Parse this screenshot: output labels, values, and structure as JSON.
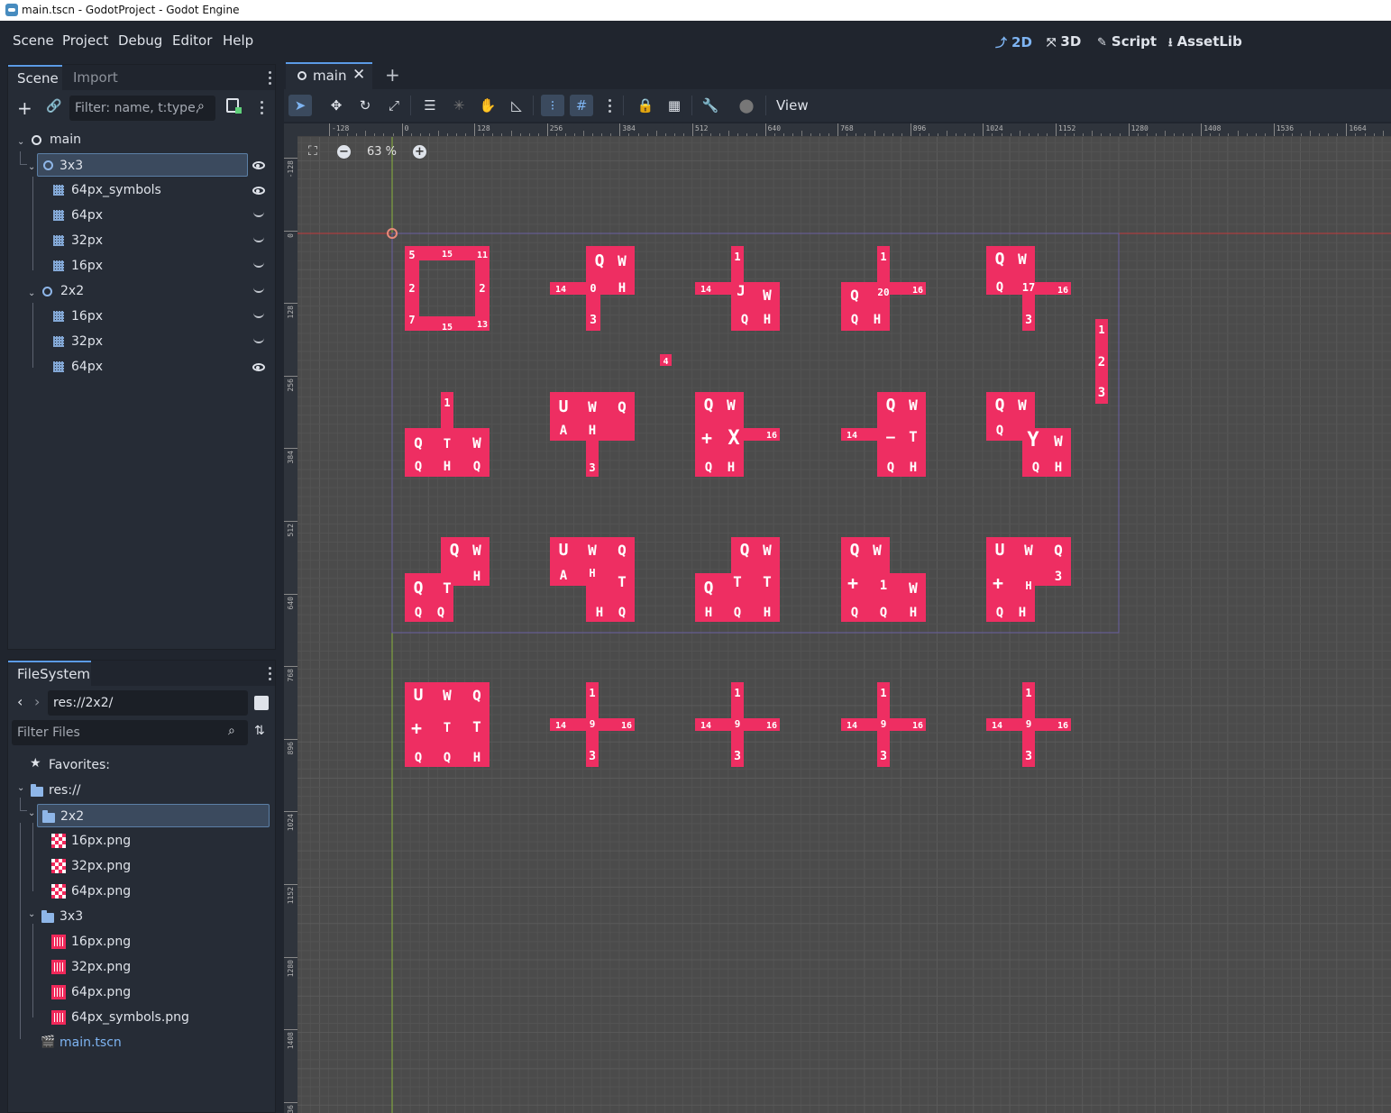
{
  "window": {
    "title": "main.tscn - GodotProject - Godot Engine"
  },
  "menu": {
    "items": [
      "Scene",
      "Project",
      "Debug",
      "Editor",
      "Help"
    ]
  },
  "workspaces": {
    "items": [
      "2D",
      "3D",
      "Script",
      "AssetLib"
    ],
    "active": "2D"
  },
  "scene_dock": {
    "tabs": [
      "Scene",
      "Import"
    ],
    "filter_placeholder": "Filter: name, t:type,",
    "tree": [
      {
        "label": "main",
        "type": "root"
      },
      {
        "label": "3x3",
        "type": "node",
        "selected": true,
        "visibility": "visible"
      },
      {
        "label": "64px_symbols",
        "type": "tilemap",
        "visibility": "visible"
      },
      {
        "label": "64px",
        "type": "tilemap",
        "visibility": "hidden"
      },
      {
        "label": "32px",
        "type": "tilemap",
        "visibility": "hidden"
      },
      {
        "label": "16px",
        "type": "tilemap",
        "visibility": "hidden"
      },
      {
        "label": "2x2",
        "type": "node",
        "visibility": "hidden"
      },
      {
        "label": "16px",
        "type": "tilemap",
        "visibility": "hidden"
      },
      {
        "label": "32px",
        "type": "tilemap",
        "visibility": "hidden"
      },
      {
        "label": "64px",
        "type": "tilemap",
        "visibility": "visible"
      }
    ]
  },
  "filesystem_dock": {
    "tab": "FileSystem",
    "path": "res://2x2/",
    "filter_placeholder": "Filter Files",
    "favorites_label": "Favorites:",
    "tree": [
      {
        "label": "res://",
        "type": "folder"
      },
      {
        "label": "2x2",
        "type": "folder",
        "selected": true
      },
      {
        "label": "16px.png",
        "type": "image"
      },
      {
        "label": "32px.png",
        "type": "image"
      },
      {
        "label": "64px.png",
        "type": "image"
      },
      {
        "label": "3x3",
        "type": "folder"
      },
      {
        "label": "16px.png",
        "type": "image"
      },
      {
        "label": "32px.png",
        "type": "image"
      },
      {
        "label": "64px.png",
        "type": "image"
      },
      {
        "label": "64px_symbols.png",
        "type": "image"
      },
      {
        "label": "main.tscn",
        "type": "scene"
      }
    ]
  },
  "editor": {
    "tab_label": "main",
    "view_menu": "View",
    "zoom": "63 %",
    "ruler_top": [
      "-128",
      "0",
      "128",
      "256",
      "384",
      "512",
      "640",
      "768",
      "896",
      "1024",
      "1152",
      "1280",
      "1408",
      "1536",
      "1664"
    ],
    "ruler_left": [
      "-128",
      "0",
      "128",
      "256",
      "384",
      "512",
      "640",
      "768",
      "896",
      "1024",
      "1152",
      "1280",
      "1408",
      "1536"
    ],
    "colors": {
      "tile": "#ee2e62",
      "canvas": "#4b4b4b",
      "accent": "#7eb4f2"
    },
    "tile_labels": {
      "r1": [
        "5",
        "15",
        "11",
        "2",
        "2",
        "7",
        "15",
        "13",
        "Q",
        "W",
        "14",
        "0",
        "H",
        "3",
        "1",
        "14",
        "J",
        "W",
        "Q",
        "H",
        "1",
        "Q",
        "20",
        "16",
        "Q",
        "H",
        "Q",
        "W",
        "Q",
        "17",
        "16",
        "3"
      ],
      "r2": [
        "1",
        "Q",
        "T",
        "W",
        "Q",
        "H",
        "Q",
        "U",
        "W",
        "Q",
        "A",
        "H",
        "3",
        "Q",
        "W",
        "+",
        "X",
        "16",
        "Q",
        "H",
        "Q",
        "W",
        "14",
        "—",
        "T",
        "Q",
        "H",
        "Q",
        "W",
        "Q",
        "Y",
        "W",
        "Q",
        "H"
      ],
      "single_4": "4",
      "side_column": [
        "1",
        "2",
        "3"
      ],
      "r4_cross": [
        "1",
        "14",
        "9",
        "16",
        "3"
      ]
    }
  }
}
